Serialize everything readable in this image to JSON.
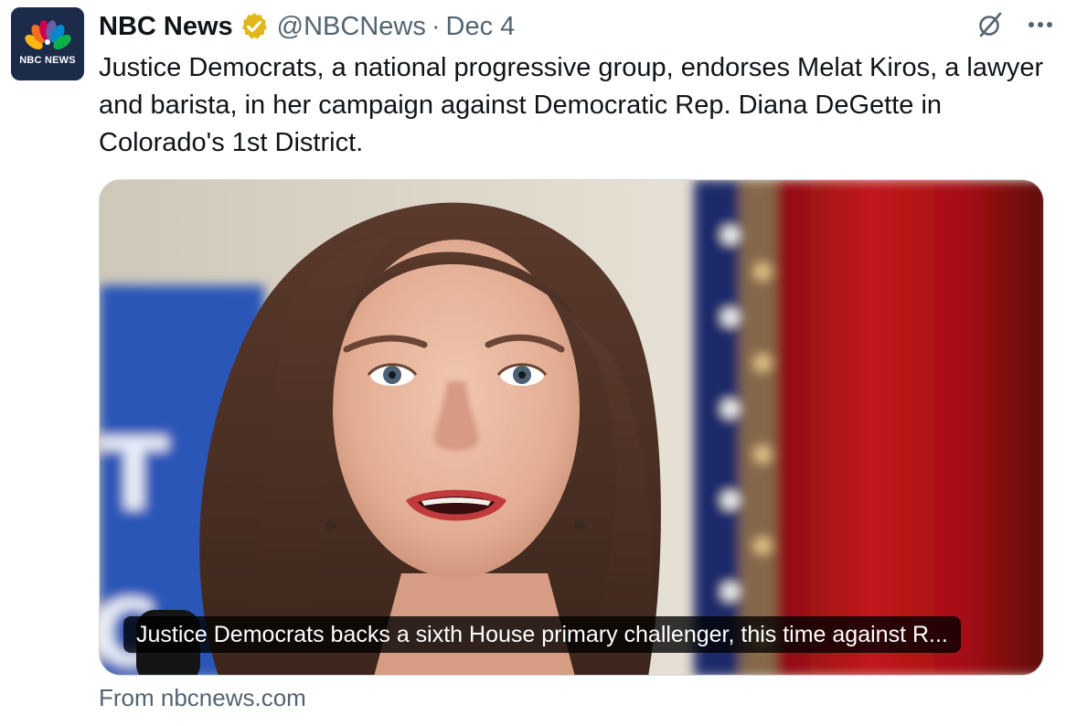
{
  "author": {
    "name": "NBC News",
    "handle": "@NBCNews",
    "separator": "·",
    "date": "Dec 4",
    "avatar_label": "NBC NEWS",
    "verified_icon": "verified-gold-badge-icon",
    "verified_color": "#e2b719"
  },
  "actions": {
    "grok_icon": "grok-icon",
    "more_icon": "more-icon"
  },
  "tweet": {
    "text": "Justice Democrats, a national progressive group, endorses Melat Kiros, a lawyer and barista, in her campaign against Democratic Rep. Diana DeGette in Colorado's 1st District."
  },
  "card": {
    "caption": "Justice Democrats backs a sixth House primary challenger, this time against R...",
    "source": "From nbcnews.com"
  },
  "colors": {
    "text_primary": "#0f1419",
    "text_secondary": "#536471",
    "border": "#cfd9de"
  }
}
